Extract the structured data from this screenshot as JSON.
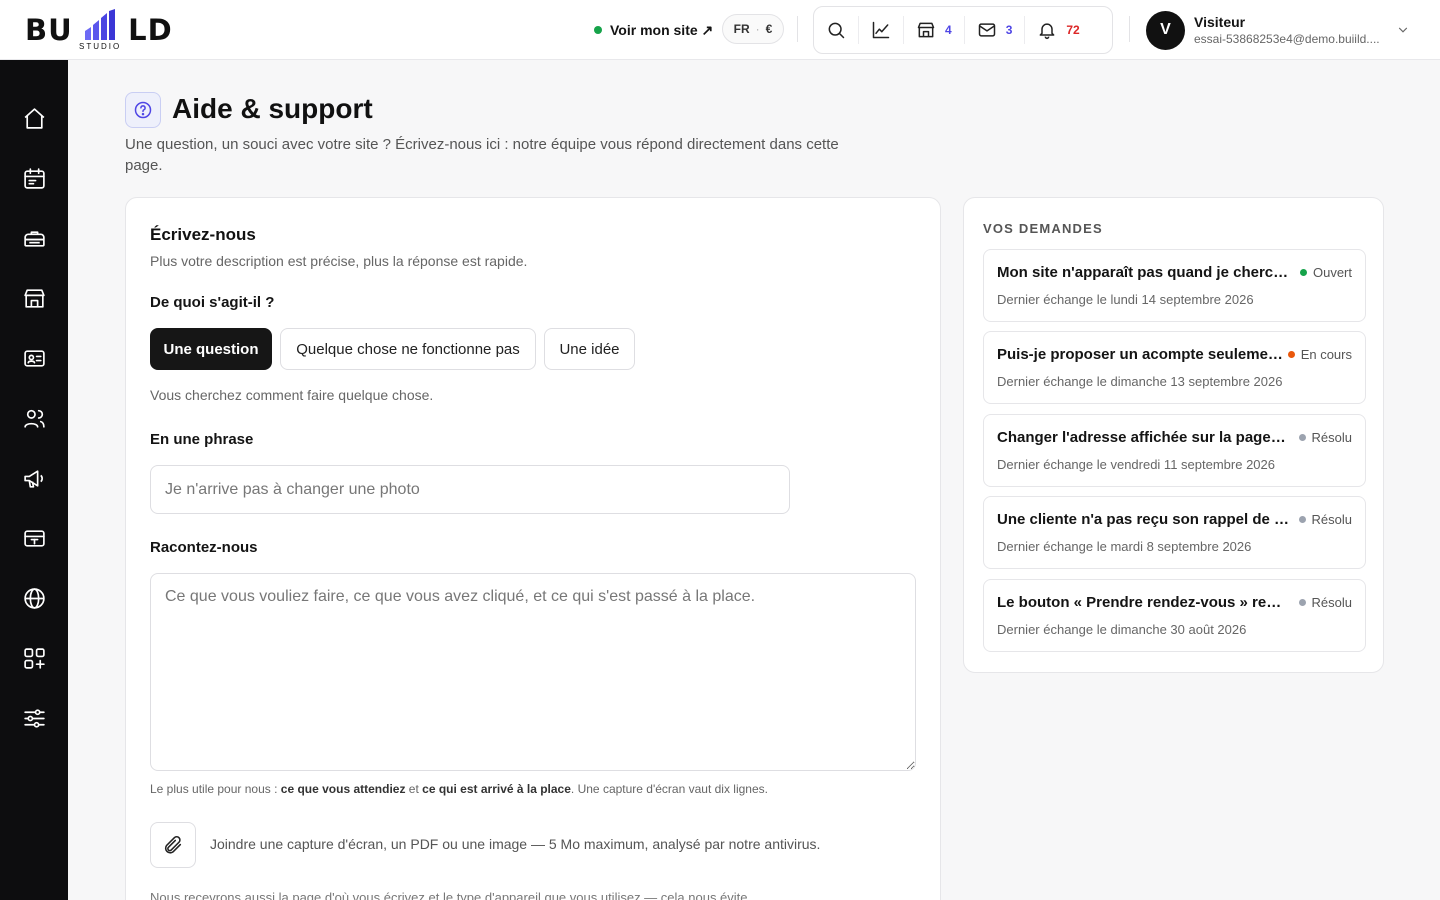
{
  "brand": {
    "name": "BU LD",
    "tagline": "STUDIO"
  },
  "header": {
    "view_site": "Voir mon site ↗",
    "lang": "FR",
    "currency": "€",
    "tools": {
      "shop_count": "4",
      "mail_count": "3",
      "notif_count": "72"
    },
    "user": {
      "initial": "V",
      "name": "Visiteur",
      "email": "essai-53868253e4@demo.buiild...."
    }
  },
  "sidebar": {
    "icons": [
      "home-icon",
      "calendar-icon",
      "services-icon",
      "store-icon",
      "contact-card-icon",
      "users-icon",
      "megaphone-icon",
      "payment-card-icon",
      "globe-icon",
      "apps-icon",
      "settings-sliders-icon"
    ]
  },
  "page": {
    "title": "Aide & support",
    "subtitle": "Une question, un souci avec votre site ? Écrivez-nous ici : notre équipe vous répond directement dans cette page."
  },
  "form": {
    "title": "Écrivez-nous",
    "subtitle": "Plus votre description est précise, plus la réponse est rapide.",
    "type_label": "De quoi s'agit-il ?",
    "types": [
      "Une question",
      "Quelque chose ne fonctionne pas",
      "Une idée"
    ],
    "selected_type": "Une question",
    "type_hint": "Vous cherchez comment faire quelque chose.",
    "summary_label": "En une phrase",
    "summary_placeholder": "Je n'arrive pas à changer une photo",
    "details_label": "Racontez-nous",
    "details_placeholder": "Ce que vous vouliez faire, ce que vous avez cliqué, et ce qui s'est passé à la place.",
    "tip": {
      "prefix": "Le plus utile pour nous : ",
      "bold1": "ce que vous attendiez",
      "mid": " et ",
      "bold2": "ce qui est arrivé à la place",
      "suffix": ". Une capture d'écran vaut dix lignes."
    },
    "attach_text": "Joindre une capture d'écran, un PDF ou une image — 5 Mo maximum, analysé par notre antivirus.",
    "privacy_text": "Nous recevrons aussi la page d'où vous écrivez et le type d'appareil que vous utilisez — cela nous évite"
  },
  "requests": {
    "title": "VOS DEMANDES",
    "items": [
      {
        "subject": "Mon site n'apparaît pas quand je cherche mon nom",
        "status": "Ouvert",
        "status_color": "#16a34a",
        "date": "Dernier échange le lundi 14 septembre 2026"
      },
      {
        "subject": "Puis-je proposer un acompte seulement ?",
        "status": "En cours",
        "status_color": "#ea580c",
        "date": "Dernier échange le dimanche 13 septembre 2026"
      },
      {
        "subject": "Changer l'adresse affichée sur la page contact",
        "status": "Résolu",
        "status_color": "#9ca3af",
        "date": "Dernier échange le vendredi 11 septembre 2026"
      },
      {
        "subject": "Une cliente n'a pas reçu son rappel de rendez-vous",
        "status": "Résolu",
        "status_color": "#9ca3af",
        "date": "Dernier échange le mardi 8 septembre 2026"
      },
      {
        "subject": "Le bouton « Prendre rendez-vous » renvoie vers une page vide",
        "status": "Résolu",
        "status_color": "#9ca3af",
        "date": "Dernier échange le dimanche 30 août 2026"
      }
    ]
  },
  "colors": {
    "accent": "#4f46e5",
    "dark": "#0d0d0f",
    "alert": "#dc2626"
  }
}
